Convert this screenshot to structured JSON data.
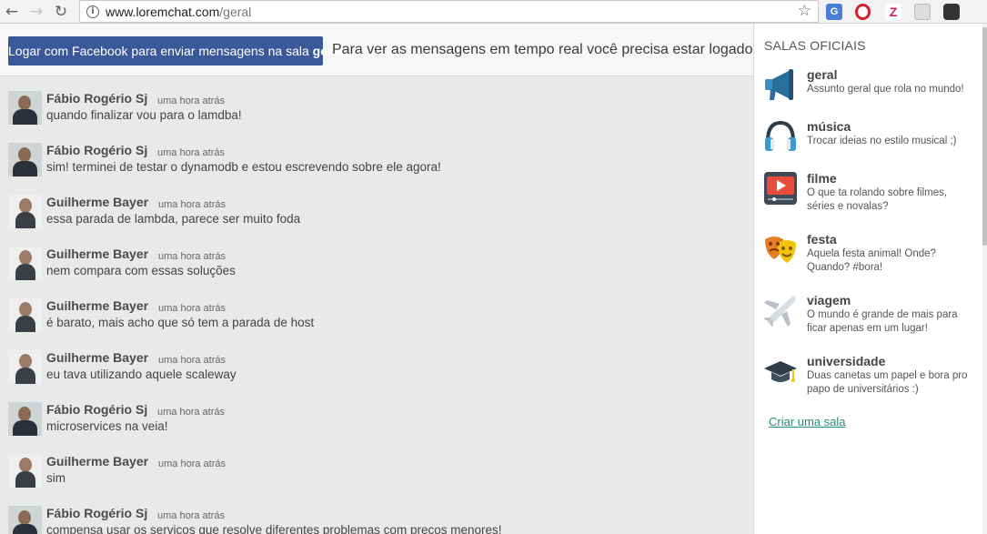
{
  "browser": {
    "url_domain": "www.loremchat.com",
    "url_path": "/geral",
    "extensions": [
      "translate-icon",
      "opera-icon",
      "zotero-icon",
      "extension-grid-icon",
      "incognito-icon"
    ]
  },
  "topbar": {
    "login_prefix": "Logar com Facebook para enviar mensagens na sala ",
    "login_room": "geral",
    "notice": "Para ver as mensagens em tempo real você precisa estar logado!"
  },
  "messages": [
    {
      "author": "Fábio Rogério Sj",
      "time": "uma hora atrás",
      "text": "quando finalizar vou para o lamdba!",
      "avatar": "fabio"
    },
    {
      "author": "Fábio Rogério Sj",
      "time": "uma hora atrás",
      "text": "sim! terminei de testar o dynamodb e estou escrevendo sobre ele agora!",
      "avatar": "fabio"
    },
    {
      "author": "Guilherme Bayer",
      "time": "uma hora atrás",
      "text": "essa parada de lambda, parece ser muito foda",
      "avatar": "guilherme"
    },
    {
      "author": "Guilherme Bayer",
      "time": "uma hora atrás",
      "text": "nem compara com essas soluções",
      "avatar": "guilherme"
    },
    {
      "author": "Guilherme Bayer",
      "time": "uma hora atrás",
      "text": "é barato, mais acho que só tem a parada de host",
      "avatar": "guilherme"
    },
    {
      "author": "Guilherme Bayer",
      "time": "uma hora atrás",
      "text": "eu tava utilizando aquele scaleway",
      "avatar": "guilherme"
    },
    {
      "author": "Fábio Rogério Sj",
      "time": "uma hora atrás",
      "text": "microservices na veia!",
      "avatar": "fabio"
    },
    {
      "author": "Guilherme Bayer",
      "time": "uma hora atrás",
      "text": "sim",
      "avatar": "guilherme"
    },
    {
      "author": "Fábio Rogério Sj",
      "time": "uma hora atrás",
      "text": "compensa usar os serviços que resolve diferentes problemas com preços menores!",
      "avatar": "fabio"
    }
  ],
  "sidebar": {
    "title": "SALAS OFICIAIS",
    "rooms": [
      {
        "name": "geral",
        "desc": "Assunto geral que rola no mundo!",
        "icon": "megaphone-icon",
        "active": true
      },
      {
        "name": "música",
        "desc": "Trocar ideias no estilo musical ;)",
        "icon": "headphones-icon"
      },
      {
        "name": "filme",
        "desc": "O que ta rolando sobre filmes, séries e novalas?",
        "icon": "video-player-icon"
      },
      {
        "name": "festa",
        "desc": "Aquela festa animal! Onde? Quando? #bora!",
        "icon": "theater-masks-icon"
      },
      {
        "name": "viagem",
        "desc": "O mundo é grande de mais para ficar apenas em um lugar!",
        "icon": "airplane-icon"
      },
      {
        "name": "universidade",
        "desc": "Duas canetas um papel e bora pro papo de universitários :)",
        "icon": "graduation-cap-icon"
      }
    ],
    "create_label": "Criar uma sala"
  },
  "colors": {
    "facebook": "#3b5998",
    "link": "#2a8c7a",
    "active_indicator": "#9ed3a1"
  }
}
